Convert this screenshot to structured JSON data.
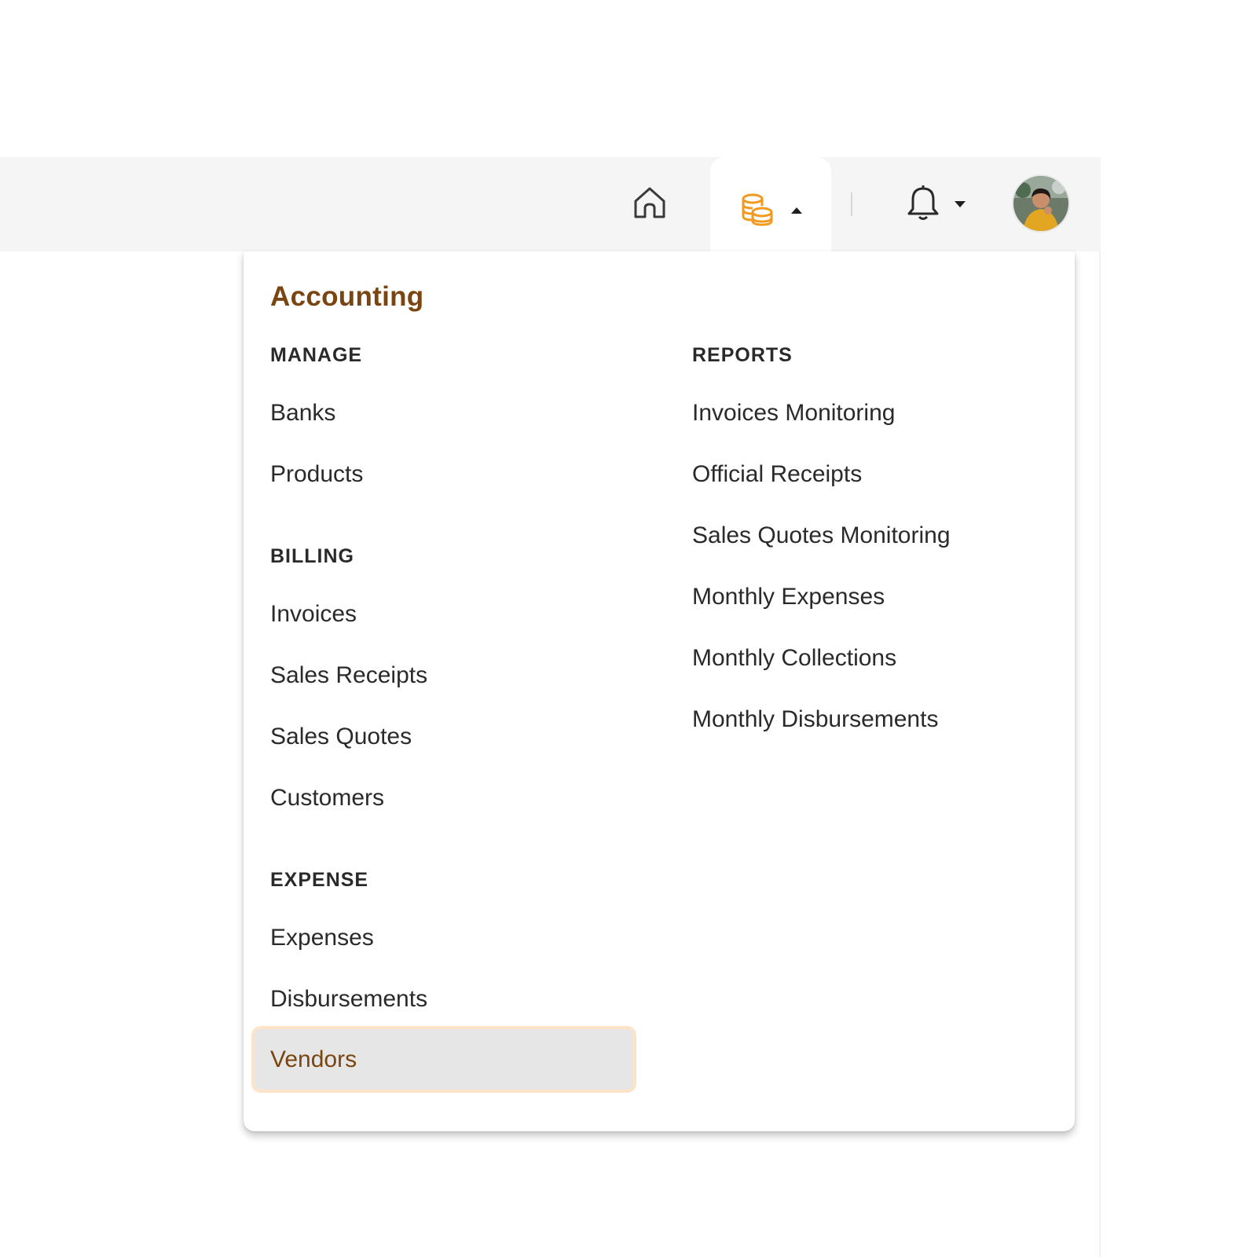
{
  "navbar": {
    "home_icon": "home-icon",
    "accounting_icon": "coins-stack-icon",
    "notifications_icon": "bell-icon",
    "avatar_alt": "user-avatar"
  },
  "colors": {
    "accent_brown": "#7a4510",
    "accent_orange": "#f29a1e",
    "selected_border": "#fde3c8",
    "selected_bg": "#e6e6e6",
    "navbar_bg": "#f5f5f5"
  },
  "menu": {
    "title": "Accounting",
    "manage": {
      "heading": "MANAGE",
      "items": [
        "Banks",
        "Products"
      ]
    },
    "billing": {
      "heading": "BILLING",
      "items": [
        "Invoices",
        "Sales Receipts",
        "Sales Quotes",
        "Customers"
      ]
    },
    "expense": {
      "heading": "EXPENSE",
      "items": [
        "Expenses",
        "Disbursements",
        "Vendors"
      ]
    },
    "reports": {
      "heading": "REPORTS",
      "items": [
        "Invoices Monitoring",
        "Official Receipts",
        "Sales Quotes Monitoring",
        "Monthly Expenses",
        "Monthly Collections",
        "Monthly Disbursements"
      ]
    },
    "selected_item": "Vendors"
  }
}
